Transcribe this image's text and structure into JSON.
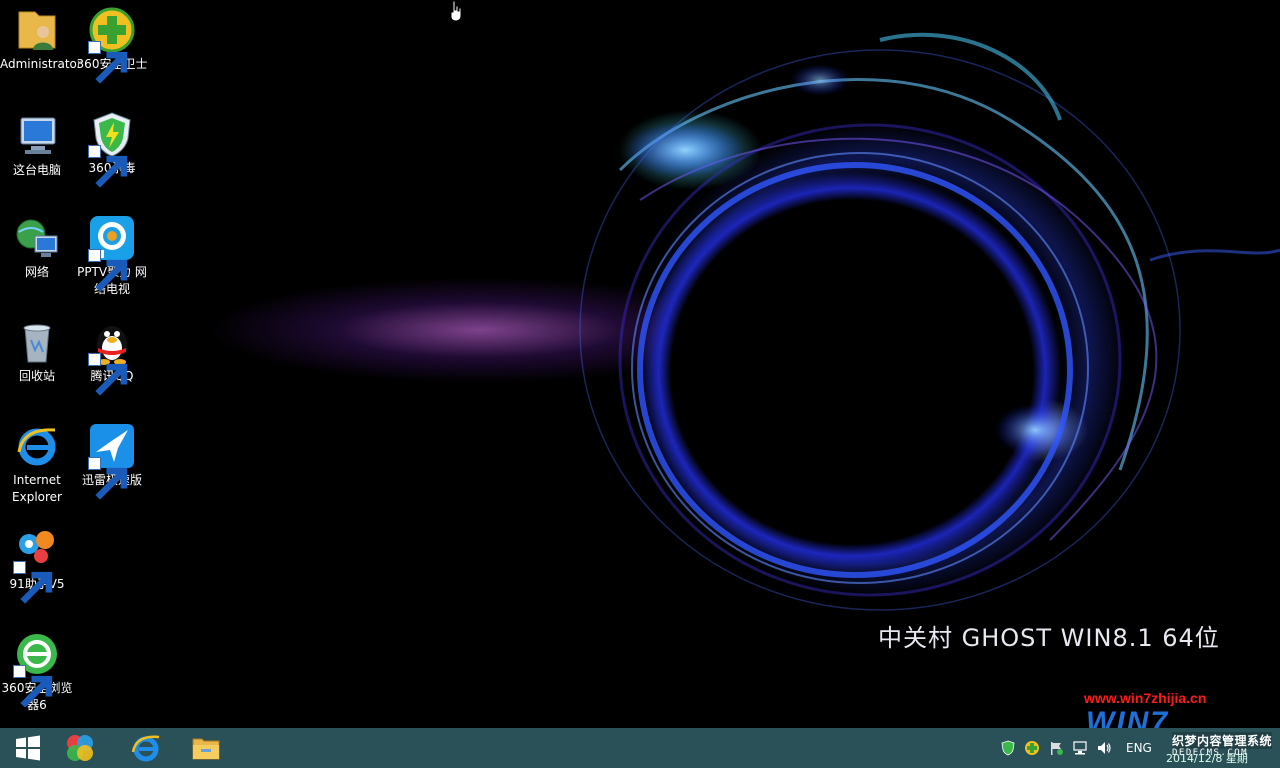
{
  "desktop": {
    "brand_text": "中关村  GHOST  WIN8.1  64位",
    "icons": [
      {
        "label": "Administrator",
        "icon": "user-folder-icon"
      },
      {
        "label": "360安全卫士",
        "icon": "360-safe-icon"
      },
      {
        "label": "这台电脑",
        "icon": "computer-icon"
      },
      {
        "label": "360杀毒",
        "icon": "360-antivirus-icon"
      },
      {
        "label": "网络",
        "icon": "network-icon"
      },
      {
        "label": "PPTV聚力 网络电视",
        "icon": "pptv-icon"
      },
      {
        "label": "回收站",
        "icon": "recycle-bin-icon"
      },
      {
        "label": "腾讯QQ",
        "icon": "qq-penguin-icon"
      },
      {
        "label": "Internet Explorer",
        "icon": "internet-explorer-icon"
      },
      {
        "label": "迅雷极速版",
        "icon": "xunlei-bird-icon"
      },
      {
        "label": "91助手V5",
        "icon": "91-assistant-icon"
      },
      {
        "label": "360安全浏览器6",
        "icon": "360-browser-icon"
      }
    ]
  },
  "taskbar": {
    "pinned": [
      "windows-start-icon",
      "360-app-icon",
      "internet-explorer-icon",
      "file-explorer-icon"
    ],
    "tray": {
      "language": "ENG",
      "clock_partial": "2014/12/8 星期",
      "icons": [
        "shield-tray-icon",
        "360-tray-icon",
        "flag-tray-icon",
        "network-tray-icon",
        "volume-tray-icon"
      ]
    }
  },
  "watermark": {
    "url": "www.win7zhijia.cn",
    "logo": "WIN7",
    "line1": "织梦内容管理系统",
    "line2": "DEDECMS.COM"
  },
  "colors": {
    "taskbar": "#2a5158",
    "watermark_red": "#ff1a1a",
    "watermark_blue": "#1e6fd8"
  }
}
